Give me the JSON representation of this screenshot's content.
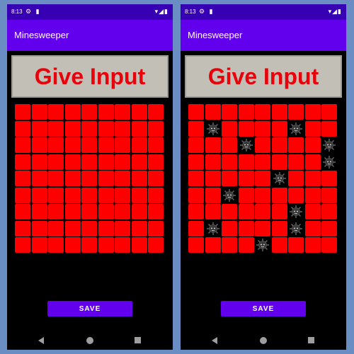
{
  "status": {
    "time": "8:13",
    "left_icons": "⚙ ▮",
    "right_icons": "▾◢▮"
  },
  "app": {
    "title": "Minesweeper"
  },
  "banner": {
    "text": "Give Input"
  },
  "save_label": "SAVE",
  "grid": {
    "rows": 9,
    "cols": 9
  },
  "colors": {
    "cell": "#ff0000",
    "mine_bg": "#000000",
    "accent": "#6200ee",
    "status_bar": "#3700b3",
    "banner_text": "#e8000b"
  },
  "screens": [
    {
      "id": "left",
      "mines": []
    },
    {
      "id": "right",
      "mines": [
        [
          1,
          1
        ],
        [
          1,
          6
        ],
        [
          2,
          3
        ],
        [
          2,
          8
        ],
        [
          3,
          8
        ],
        [
          4,
          5
        ],
        [
          5,
          2
        ],
        [
          6,
          6
        ],
        [
          7,
          1
        ],
        [
          7,
          6
        ],
        [
          8,
          4
        ]
      ]
    }
  ],
  "icons": {
    "mine": "mine-icon",
    "back": "back-icon",
    "home": "home-icon",
    "recents": "recents-icon"
  }
}
